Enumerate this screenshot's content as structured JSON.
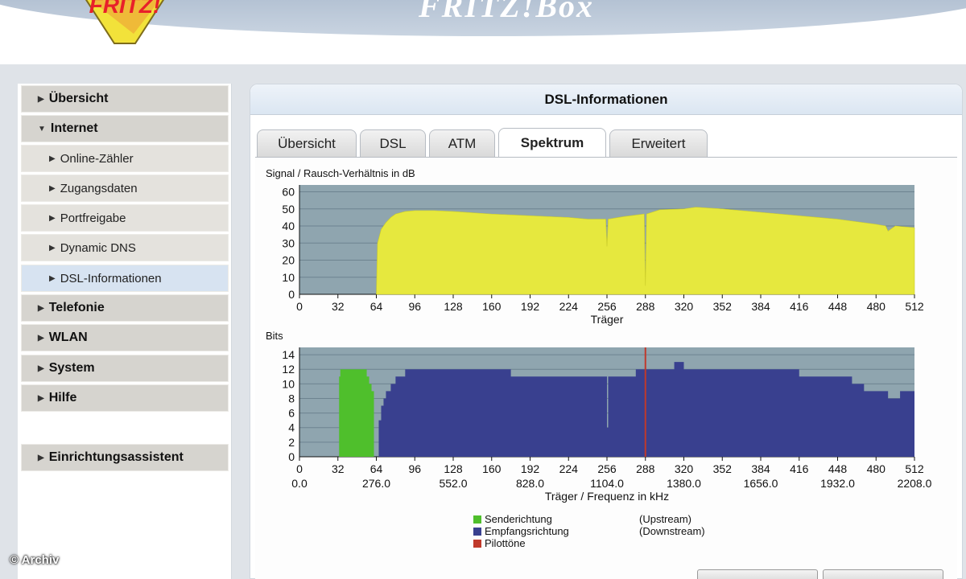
{
  "header": {
    "logo_text": "FRITZ!",
    "title": "FRITZ!Box"
  },
  "sidebar": {
    "items": [
      {
        "label": "Übersicht",
        "type": "main"
      },
      {
        "label": "Internet",
        "type": "main",
        "expanded": true
      },
      {
        "label": "Online-Zähler",
        "type": "sub"
      },
      {
        "label": "Zugangsdaten",
        "type": "sub"
      },
      {
        "label": "Portfreigabe",
        "type": "sub"
      },
      {
        "label": "Dynamic DNS",
        "type": "sub"
      },
      {
        "label": "DSL-Informationen",
        "type": "sub",
        "active": true
      },
      {
        "label": "Telefonie",
        "type": "main"
      },
      {
        "label": "WLAN",
        "type": "main"
      },
      {
        "label": "System",
        "type": "main"
      },
      {
        "label": "Hilfe",
        "type": "main"
      },
      {
        "label": "Einrichtungsassistent",
        "type": "main"
      }
    ]
  },
  "content": {
    "title": "DSL-Informationen",
    "tabs": [
      {
        "label": "Übersicht"
      },
      {
        "label": "DSL"
      },
      {
        "label": "ATM"
      },
      {
        "label": "Spektrum",
        "active": true
      },
      {
        "label": "Erweitert"
      }
    ]
  },
  "chart_data": [
    {
      "type": "area",
      "title": "Signal / Rausch-Verhältnis in dB",
      "xlabel": "Träger",
      "x_ticks": [
        0,
        32,
        64,
        96,
        128,
        160,
        192,
        224,
        256,
        288,
        320,
        352,
        384,
        416,
        448,
        480,
        512
      ],
      "y_ticks": [
        0,
        10,
        20,
        30,
        40,
        50,
        60
      ],
      "xlim": [
        0,
        512
      ],
      "ylim": [
        0,
        64
      ],
      "grid": true,
      "colors": {
        "fill": "#e6e83e",
        "background": "#8fa5af"
      },
      "series": [
        {
          "x": [
            64,
            65,
            68,
            72,
            76,
            80,
            88,
            96,
            112,
            128,
            160,
            192,
            224,
            240,
            255,
            256,
            257,
            270,
            287,
            288,
            289,
            300,
            320,
            330,
            352,
            384,
            416,
            448,
            480,
            488,
            490,
            496,
            512
          ],
          "y": [
            0,
            30,
            38,
            42,
            45,
            47,
            48.5,
            49,
            49,
            48.5,
            47,
            46,
            45,
            44,
            44,
            28,
            44,
            45.5,
            47,
            5,
            47,
            49.5,
            50,
            51,
            50,
            48,
            46,
            44,
            41,
            40,
            37,
            40,
            39
          ]
        }
      ]
    },
    {
      "type": "bar",
      "title": "Bits",
      "xlabel": "Träger / Frequenz in kHz",
      "x_ticks": [
        0,
        32,
        64,
        96,
        128,
        160,
        192,
        224,
        256,
        288,
        320,
        352,
        384,
        416,
        448,
        480,
        512
      ],
      "freq_ticks": [
        "0.0",
        "276.0",
        "552.0",
        "828.0",
        "1104.0",
        "1380.0",
        "1656.0",
        "1932.0",
        "2208.0"
      ],
      "y_ticks": [
        0,
        2,
        4,
        6,
        8,
        10,
        12,
        14
      ],
      "xlim": [
        0,
        512
      ],
      "ylim": [
        0,
        15
      ],
      "grid": true,
      "pilot_tone": 288,
      "series": [
        {
          "name": "Senderichtung",
          "color": "#4fbf2c",
          "x": [
            33,
            34,
            36,
            38,
            40,
            44,
            48,
            52,
            54,
            56,
            58,
            60,
            62
          ],
          "y": [
            11,
            12,
            12,
            12,
            12,
            12,
            12,
            12,
            12,
            11,
            10,
            9,
            0
          ]
        },
        {
          "name": "Empfangsrichtung",
          "color": "#39408f",
          "x": [
            66,
            68,
            70,
            72,
            76,
            80,
            84,
            88,
            96,
            128,
            160,
            176,
            192,
            224,
            240,
            255,
            256,
            257,
            270,
            280,
            287,
            288,
            289,
            300,
            312,
            320,
            330,
            352,
            384,
            400,
            416,
            448,
            460,
            470,
            480,
            490,
            500,
            512
          ],
          "y": [
            5,
            7,
            8,
            9,
            10,
            11,
            11,
            12,
            12,
            12,
            12,
            11,
            11,
            11,
            11,
            11,
            4,
            11,
            11,
            12,
            12,
            12,
            12,
            12,
            13,
            12,
            12,
            12,
            12,
            12,
            11,
            11,
            10,
            9,
            9,
            8,
            9,
            9
          ]
        }
      ],
      "legend": [
        {
          "label": "Senderichtung",
          "direction": "(Upstream)",
          "color": "#4fbf2c"
        },
        {
          "label": "Empfangsrichtung",
          "direction": "(Downstream)",
          "color": "#39408f"
        },
        {
          "label": "Pilottöne",
          "direction": "",
          "color": "#c0392b"
        }
      ]
    }
  ],
  "watermark": "© Archiv"
}
